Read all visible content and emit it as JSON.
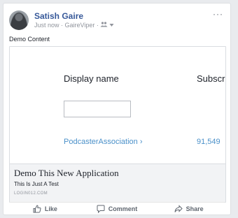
{
  "post": {
    "author": "Satish Gaire",
    "meta": "Just now · GaireViper ·",
    "audience_icon": "people-icon",
    "more_label": "···",
    "text": "Demo Content"
  },
  "preview": {
    "table": {
      "columns": [
        "Display name",
        "Subscrib"
      ],
      "rows": [
        [
          "PodcasterAssociation ›",
          "91,549"
        ]
      ]
    },
    "title": "Demo This New Application",
    "description": "This Is Just A Test",
    "domain": "LOGIN012.COM"
  },
  "actions": {
    "like": "Like",
    "comment": "Comment",
    "share": "Share"
  },
  "colors": {
    "author": "#365899",
    "link": "#4a90c9",
    "card_border": "#dddfe2",
    "page_background": "#e9ebee"
  }
}
